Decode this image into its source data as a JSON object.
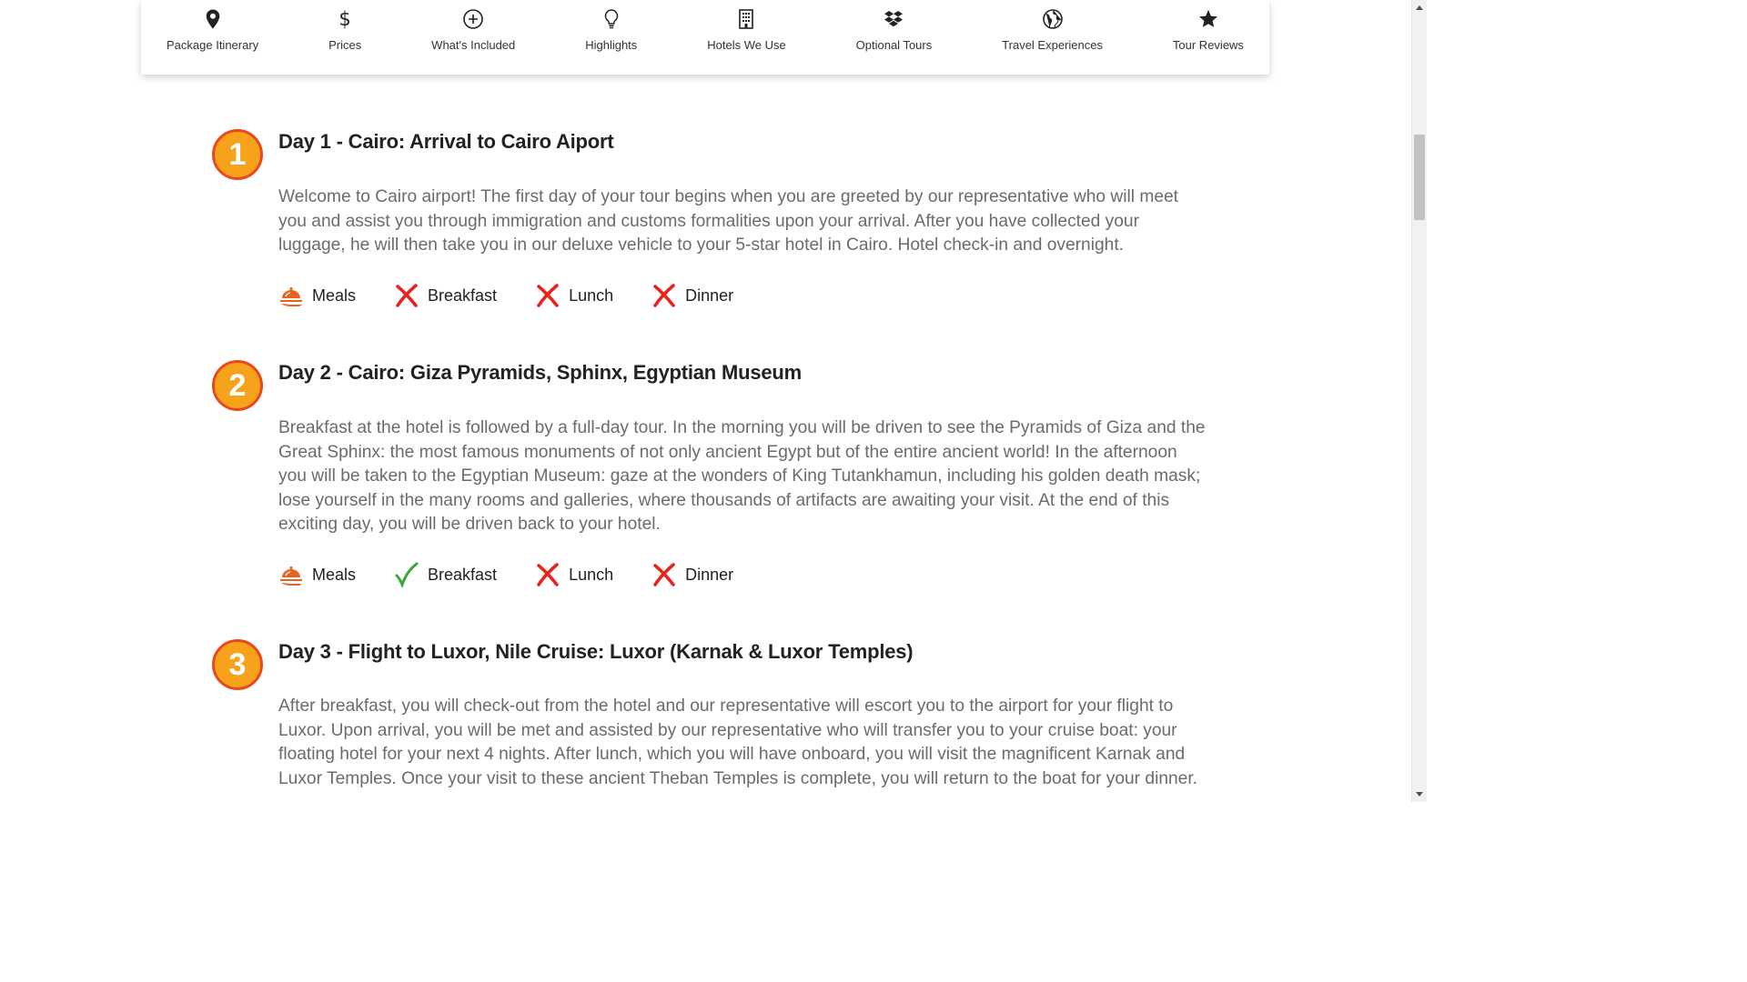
{
  "nav": {
    "items": [
      {
        "label": "Package Itinerary",
        "icon": "map-pin-icon"
      },
      {
        "label": "Prices",
        "icon": "dollar-icon"
      },
      {
        "label": "What's Included",
        "icon": "plus-circle-icon"
      },
      {
        "label": "Highlights",
        "icon": "lightbulb-icon"
      },
      {
        "label": "Hotels We Use",
        "icon": "building-icon"
      },
      {
        "label": "Optional Tours",
        "icon": "dropbox-icon"
      },
      {
        "label": "Travel Experiences",
        "icon": "globe-icon"
      },
      {
        "label": "Tour Reviews",
        "icon": "star-icon"
      }
    ]
  },
  "days": [
    {
      "number": "1",
      "title": "Day 1 - Cairo: Arrival to Cairo Aiport",
      "description": "Welcome to Cairo airport! The first day of your tour begins when you are greeted by our representative who will meet you and assist you through immigration and customs formalities upon your arrival. After you have collected your luggage, he will then take you in our deluxe vehicle to your 5-star hotel in Cairo. Hotel check-in and overnight.",
      "meals": {
        "label": "Meals",
        "breakfast": {
          "label": "Breakfast",
          "included": false
        },
        "lunch": {
          "label": "Lunch",
          "included": false
        },
        "dinner": {
          "label": "Dinner",
          "included": false
        }
      }
    },
    {
      "number": "2",
      "title": "Day 2 - Cairo: Giza Pyramids, Sphinx, Egyptian Museum",
      "description": "Breakfast at the hotel is followed by a full-day tour. In the morning you will be driven to see the Pyramids of Giza and the Great Sphinx: the most famous monuments of not only ancient Egypt but of the entire ancient world! In the afternoon you will be taken to the Egyptian Museum: gaze at the wonders of King Tutankhamun, including his golden death mask; lose yourself in the many rooms and galleries, where thousands of artifacts are awaiting your visit. At the end of this exciting day, you will be driven back to your hotel.",
      "meals": {
        "label": "Meals",
        "breakfast": {
          "label": "Breakfast",
          "included": true
        },
        "lunch": {
          "label": "Lunch",
          "included": false
        },
        "dinner": {
          "label": "Dinner",
          "included": false
        }
      }
    },
    {
      "number": "3",
      "title": "Day 3 - Flight to Luxor, Nile Cruise: Luxor (Karnak & Luxor Temples)",
      "description": "After breakfast, you will check-out from the hotel and our representative will escort you to the airport for your flight to Luxor. Upon arrival, you will be met and assisted by our representative who will transfer you to your cruise boat: your floating hotel for your next 4 nights. After lunch, which you will have onboard, you will visit the magnificent Karnak and Luxor Temples. Once your visit to these ancient Theban Temples is complete, you will return to the boat for your dinner."
    }
  ],
  "colors": {
    "badge_fill": "#f7a21b",
    "badge_border": "#e8491d",
    "meal_icon": "#e8641d",
    "cross": "#e8231d",
    "check": "#3aa83a"
  }
}
